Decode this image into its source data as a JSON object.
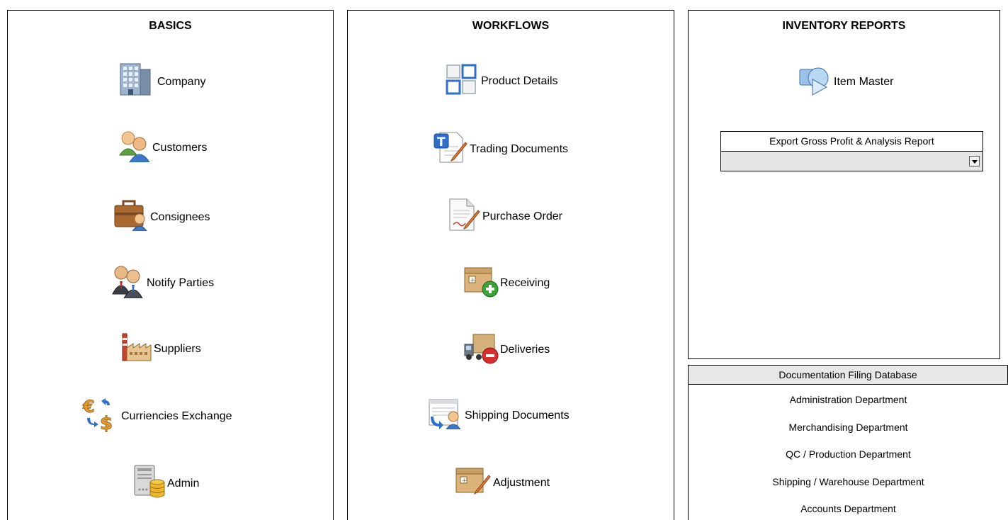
{
  "basics": {
    "title": "BASICS",
    "items": [
      {
        "label": "Company",
        "icon": "building-icon"
      },
      {
        "label": "Customers",
        "icon": "customers-icon"
      },
      {
        "label": "Consignees",
        "icon": "briefcase-user-icon"
      },
      {
        "label": "Notify Parties",
        "icon": "business-people-icon"
      },
      {
        "label": "Suppliers",
        "icon": "factory-icon"
      },
      {
        "label": "Curriencies Exchange",
        "icon": "currency-exchange-icon"
      },
      {
        "label": "Admin",
        "icon": "server-database-icon"
      }
    ]
  },
  "workflows": {
    "title": "WORKFLOWS",
    "items": [
      {
        "label": "Product Details",
        "icon": "grid-squares-icon"
      },
      {
        "label": "Trading Documents",
        "icon": "document-edit-icon"
      },
      {
        "label": "Purchase Order",
        "icon": "signed-document-icon"
      },
      {
        "label": "Receiving",
        "icon": "box-add-icon"
      },
      {
        "label": "Deliveries",
        "icon": "truck-remove-icon"
      },
      {
        "label": "Shipping Documents",
        "icon": "shipping-document-icon"
      },
      {
        "label": "Adjustment",
        "icon": "box-edit-icon"
      }
    ]
  },
  "reports": {
    "title": "INVENTORY REPORTS",
    "item_master": {
      "label": "Item Master",
      "icon": "item-master-icon"
    },
    "export_report": {
      "label": "Export Gross Profit & Analysis Report",
      "selected": ""
    }
  },
  "filing": {
    "title": "Documentation Filing Database",
    "departments": [
      "Administration Department",
      "Merchandising Department",
      "QC / Production Department",
      "Shipping / Warehouse Department",
      "Accounts Department"
    ]
  },
  "colors": {
    "border": "#000000",
    "header_bg": "#e8e8e8",
    "dropdown_bg": "#e6e6e6",
    "icon_blue": "#2f6fc9",
    "icon_orange": "#e89a2c"
  }
}
